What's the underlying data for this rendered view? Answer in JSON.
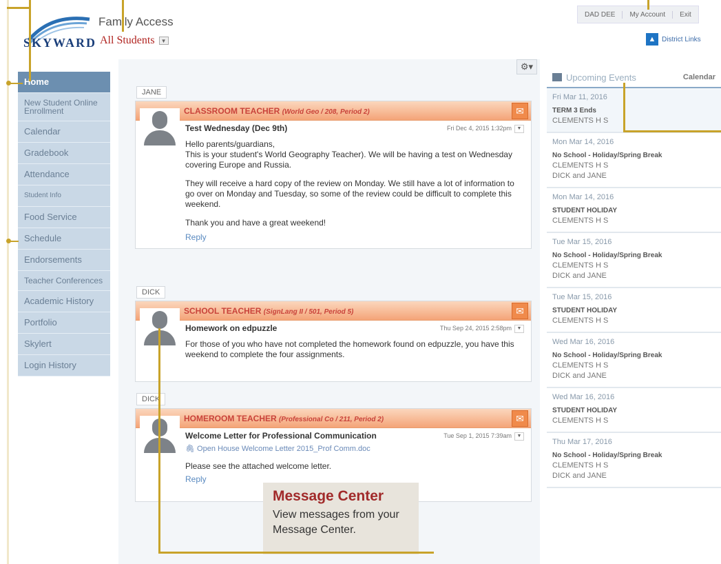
{
  "header": {
    "logo_text": "SKYWARD",
    "app_title": "Family Access",
    "student_selector": "All Students",
    "top_links": [
      "DAD DEE",
      "My Account",
      "Exit"
    ],
    "district_links": "District Links"
  },
  "sidebar": {
    "items": [
      {
        "label": "Home"
      },
      {
        "label": "New Student Online Enrollment"
      },
      {
        "label": "Calendar"
      },
      {
        "label": "Gradebook"
      },
      {
        "label": "Attendance"
      },
      {
        "label": "Student Info"
      },
      {
        "label": "Food Service"
      },
      {
        "label": "Schedule"
      },
      {
        "label": "Endorsements"
      },
      {
        "label": "Teacher Conferences"
      },
      {
        "label": "Academic History"
      },
      {
        "label": "Portfolio"
      },
      {
        "label": "Skylert"
      },
      {
        "label": "Login History"
      }
    ]
  },
  "messages": [
    {
      "student": "JANE",
      "teacher": "CLASSROOM TEACHER",
      "course": "(World Geo / 208, Period 2)",
      "subject": "Test Wednesday (Dec 9th)",
      "date": "Fri Dec 4, 2015 1:32pm",
      "body": [
        "Hello parents/guardians,\nThis is your student's World Geography Teacher). We will be having a test on Wednesday covering Europe and Russia.",
        "They will receive a hard copy of the review on Monday. We still have a lot of information to go over on Monday and Tuesday, so some of the review could be difficult to complete this weekend.",
        "Thank you and have a great weekend!"
      ],
      "reply": "Reply"
    },
    {
      "student": "DICK",
      "teacher": "SCHOOL TEACHER",
      "course": "(SignLang II / 501, Period 5)",
      "subject": "Homework on edpuzzle",
      "date": "Thu Sep 24, 2015 2:58pm",
      "body": [
        "For those of you who have not completed the homework found on edpuzzle, you have this weekend to complete the four assignments."
      ]
    },
    {
      "student": "DICK",
      "teacher": "HOMEROOM TEACHER",
      "course": "(Professional Co / 211, Period 2)",
      "subject": "Welcome Letter for Professional Communication",
      "date": "Tue Sep 1, 2015 7:39am",
      "attachment": "Open House Welcome Letter 2015_Prof Comm.doc",
      "body": [
        "Please see the attached welcome letter."
      ],
      "reply": "Reply"
    }
  ],
  "events": {
    "title": "Upcoming Events",
    "calendar_link": "Calendar",
    "days": [
      {
        "date": "Fri Mar 11, 2016",
        "name": "TERM 3 Ends",
        "lines": [
          "CLEMENTS H S"
        ]
      },
      {
        "date": "Mon Mar 14, 2016",
        "name": "No School - Holiday/Spring Break",
        "lines": [
          "CLEMENTS H S",
          "DICK and JANE"
        ]
      },
      {
        "date": "Mon Mar 14, 2016",
        "name": "STUDENT HOLIDAY",
        "lines": [
          "CLEMENTS H S"
        ]
      },
      {
        "date": "Tue Mar 15, 2016",
        "name": "No School - Holiday/Spring Break",
        "lines": [
          "CLEMENTS H S",
          "DICK and JANE"
        ]
      },
      {
        "date": "Tue Mar 15, 2016",
        "name": "STUDENT HOLIDAY",
        "lines": [
          "CLEMENTS H S"
        ]
      },
      {
        "date": "Wed Mar 16, 2016",
        "name": "No School - Holiday/Spring Break",
        "lines": [
          "CLEMENTS H S",
          "DICK and JANE"
        ]
      },
      {
        "date": "Wed Mar 16, 2016",
        "name": "STUDENT HOLIDAY",
        "lines": [
          "CLEMENTS H S"
        ]
      },
      {
        "date": "Thu Mar 17, 2016",
        "name": "No School - Holiday/Spring Break",
        "lines": [
          "CLEMENTS H S",
          "DICK and JANE"
        ]
      }
    ]
  },
  "callout": {
    "title": "Message Center",
    "text": "View messages from your Message Center."
  },
  "colors": {
    "accent": "#c8a32a",
    "teacher_header": "#f4a478",
    "teacher_text": "#c9433a",
    "nav_active": "#6c8fb0",
    "brand": "#1b3f7a"
  },
  "icons": {
    "gear": "gear-icon",
    "mail": "mail-icon",
    "avatar": "avatar-icon",
    "calendar": "calendar-icon",
    "attachment": "paperclip-icon"
  }
}
